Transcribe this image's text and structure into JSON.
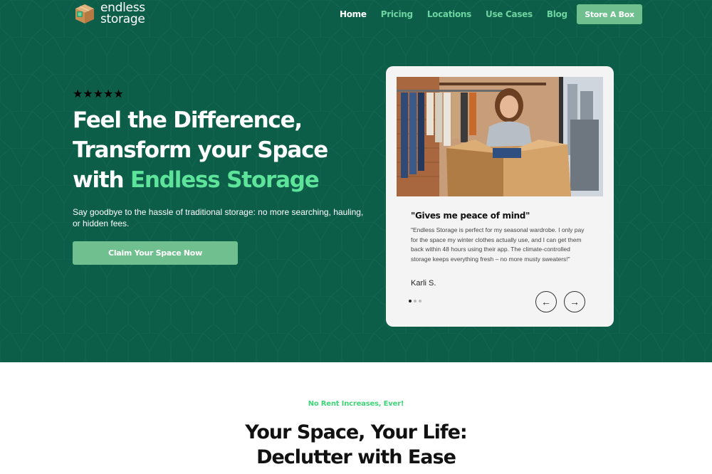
{
  "brand": {
    "line1": "endless",
    "line2": "storage"
  },
  "nav": {
    "links": [
      "Home",
      "Pricing",
      "Locations",
      "Use Cases",
      "Blog"
    ],
    "active_index": 0,
    "cta": "Store A Box"
  },
  "hero": {
    "rating": 5,
    "stars": "★★★★★",
    "headline_line1": "Feel the Difference,",
    "headline_line2": "Transform your Space",
    "headline_line3_prefix": "with ",
    "headline_accent": "Endless Storage",
    "subtext": "Say goodbye to the hassle of traditional storage: no more searching, hauling, or hidden fees.",
    "cta": "Claim Your Space Now"
  },
  "testimonial": {
    "title": "\"Gives me peace of mind\"",
    "text": "\"Endless Storage is perfect for my seasonal wardrobe. I only pay for the space my winter clothes actually use, and I can get them back within 48 hours using their app. The climate-controlled storage keeps everything fresh – no more musty sweaters!\"",
    "author": "Karli S.",
    "slide_count": 3,
    "active_slide": 0,
    "prev_icon": "←",
    "next_icon": "→"
  },
  "section": {
    "tag": "No Rent Increases, Ever!",
    "title_line1": "Your Space, Your Life:",
    "title_line2": "Declutter with Ease"
  },
  "colors": {
    "hero_bg": "#0c5e48",
    "accent_green": "#5de39a",
    "button_green": "#6fbf8f",
    "star_yellow": "#f5c518",
    "tag_green": "#3fd477"
  }
}
